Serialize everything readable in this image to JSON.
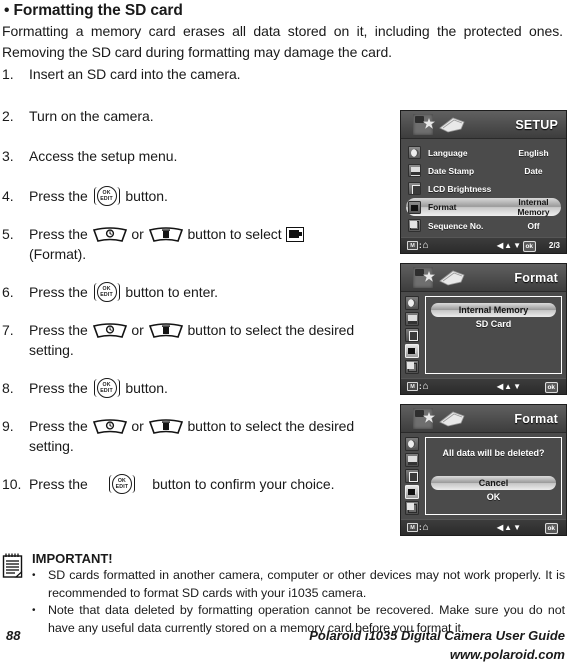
{
  "heading": "• Formatting the SD card",
  "intro": "Formatting a memory card erases all data stored on it, including the protected ones. Removing the SD card during formatting may damage the card.",
  "steps": [
    {
      "num": "1.",
      "pre": "Insert an SD card into the camera.",
      "post": ""
    },
    {
      "num": "2.",
      "pre": "Turn on the camera.",
      "post": ""
    },
    {
      "num": "3.",
      "pre": "Access the setup menu.",
      "post": ""
    },
    {
      "num": "4.",
      "pre": "Press the",
      "post": "button."
    },
    {
      "num": "5.",
      "pre": "Press the",
      "mid": "or",
      "post": "button to select",
      "post2": "(Format)."
    },
    {
      "num": "6.",
      "pre": "Press the",
      "post": "button to enter."
    },
    {
      "num": "7.",
      "pre": "Press the",
      "mid": "or",
      "post": "button to select the desired setting."
    },
    {
      "num": "8.",
      "pre": "Press the",
      "post": "button."
    },
    {
      "num": "9.",
      "pre": "Press the",
      "mid": "or",
      "post": "button to select the desired setting."
    },
    {
      "num": "10.",
      "pre": "Press the",
      "post": "button to confirm your choice."
    }
  ],
  "button_labels": {
    "ok": "OK",
    "edit": "EDIT"
  },
  "screens": [
    {
      "title": "SETUP",
      "rows": [
        {
          "icon": "globe-icon",
          "label": "Language",
          "value": "English",
          "selected": false
        },
        {
          "icon": "date-stamp-icon",
          "label": "Date Stamp",
          "value": "Date",
          "selected": false
        },
        {
          "icon": "lcd-brightness-icon",
          "label": "LCD Brightness",
          "value": "",
          "selected": false
        },
        {
          "icon": "format-icon",
          "label": "Format",
          "value": "Internal Memory",
          "selected": true
        },
        {
          "icon": "sequence-no-icon",
          "label": "Sequence No.",
          "value": "Off",
          "selected": false
        }
      ],
      "footer": {
        "key": "M",
        "colon": ":",
        "home": "⌂",
        "dirs": "◀▲▼",
        "ok": "ok",
        "page": "2/3"
      }
    },
    {
      "title": "Format",
      "options": [
        {
          "label": "Internal Memory",
          "selected": true
        },
        {
          "label": "SD Card",
          "selected": false
        }
      ],
      "footer": {
        "key": "M",
        "colon": ":",
        "home": "⌂",
        "dirs": "◀▲▼",
        "ok": "ok",
        "page": ""
      }
    },
    {
      "title": "Format",
      "question": "All data will be deleted?",
      "options": [
        {
          "label": "Cancel",
          "selected": true
        },
        {
          "label": "OK",
          "selected": false
        }
      ],
      "footer": {
        "key": "M",
        "colon": ":",
        "home": "⌂",
        "dirs": "◀▲▼",
        "ok": "ok",
        "page": ""
      }
    }
  ],
  "important": {
    "title": "IMPORTANT!",
    "bullet_char": "•",
    "items": [
      "SD cards formatted in another camera, computer or other devices may not work properly. It is recommended to format SD cards with your i1035 camera.",
      "Note that data deleted by formatting operation cannot be recovered. Make sure you do not have any useful data currently stored on a memory card before you format it."
    ]
  },
  "footer": {
    "page_number": "88",
    "guide_title": "Polaroid i1035 Digital Camera User Guide",
    "url": "www.polaroid.com"
  }
}
